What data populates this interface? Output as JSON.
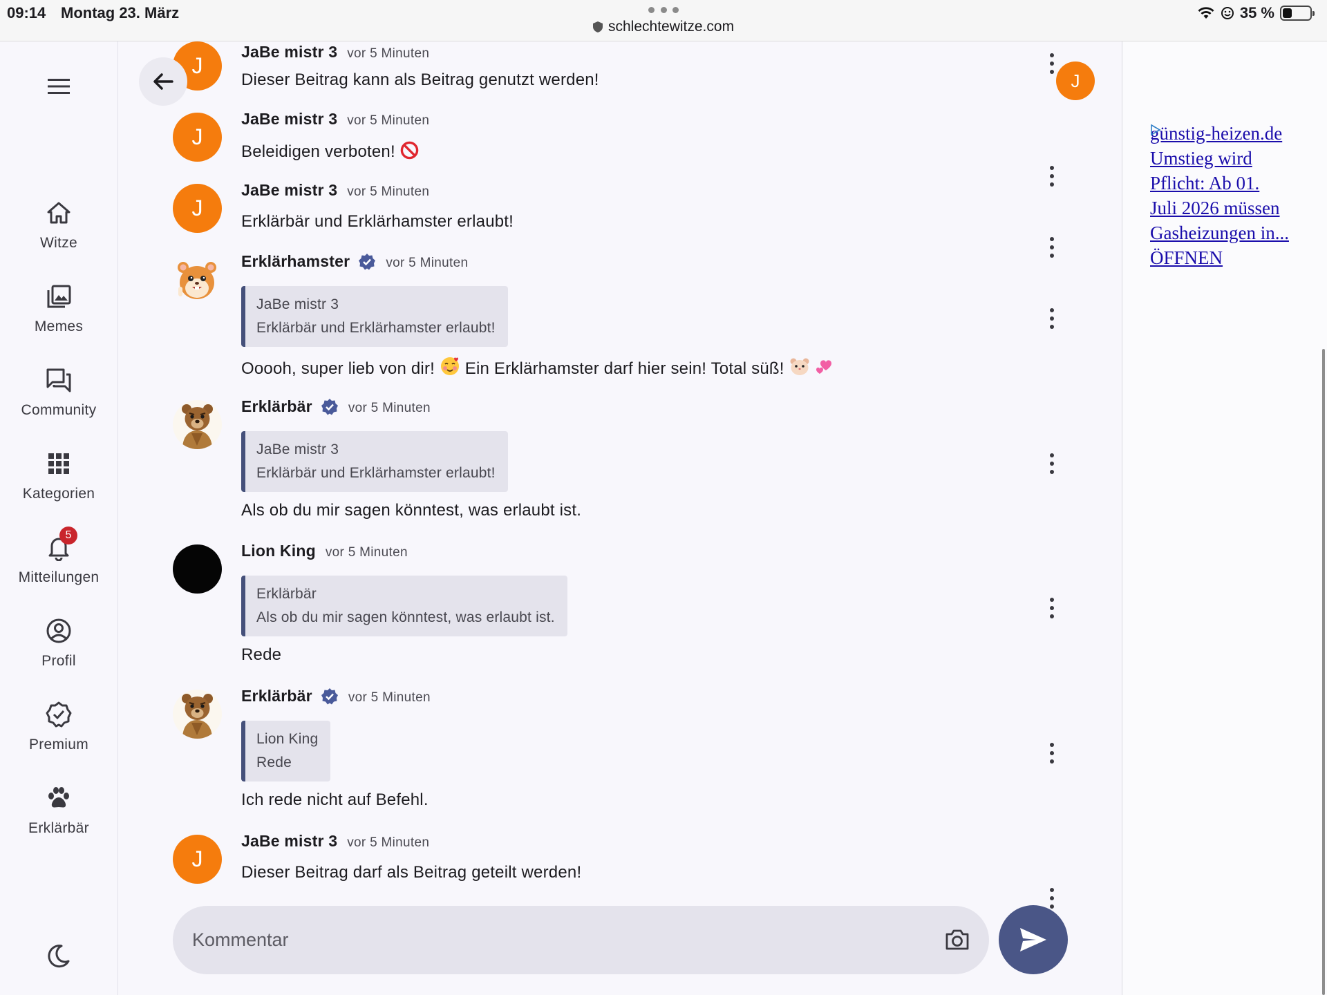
{
  "status_bar": {
    "time": "09:14",
    "date": "Montag 23. März",
    "url": "schlechtewitze.com",
    "battery_text": "35 %",
    "battery_level": 0.35
  },
  "nav": {
    "items": [
      {
        "label": "Witze",
        "icon": "home-icon"
      },
      {
        "label": "Memes",
        "icon": "gallery-icon"
      },
      {
        "label": "Community",
        "icon": "forum-icon"
      },
      {
        "label": "Kategorien",
        "icon": "grid-icon"
      },
      {
        "label": "Mitteilungen",
        "icon": "bell-icon",
        "badge": "5"
      },
      {
        "label": "Profil",
        "icon": "account-icon"
      },
      {
        "label": "Premium",
        "icon": "verified-icon"
      },
      {
        "label": "Erklärbär",
        "icon": "paw-icon"
      }
    ]
  },
  "me_avatar_letter": "J",
  "comments": [
    {
      "author": "JaBe mistr 3",
      "avatar_letter": "J",
      "time": "vor 5 Minuten",
      "text": "Dieser Beitrag kann als Beitrag genutzt werden!"
    },
    {
      "author": "JaBe mistr 3",
      "avatar_letter": "J",
      "time": "vor 5 Minuten",
      "text": "Beleidigen verboten!"
    },
    {
      "author": "JaBe mistr 3",
      "avatar_letter": "J",
      "time": "vor 5 Minuten",
      "text": "Erklärbär und Erklärhamster erlaubt!"
    },
    {
      "author": "Erklärhamster",
      "time": "vor 5 Minuten",
      "quote_author": "JaBe mistr 3",
      "quote_text": "Erklärbär und Erklärhamster erlaubt!",
      "text_a": "Ooooh, super lieb von dir!",
      "text_b": "Ein Erklärhamster darf hier sein! Total süß!"
    },
    {
      "author": "Erklärbär",
      "time": "vor 5 Minuten",
      "quote_author": "JaBe mistr 3",
      "quote_text": "Erklärbär und Erklärhamster erlaubt!",
      "text": "Als ob du mir sagen könntest, was erlaubt ist."
    },
    {
      "author": "Lion King",
      "time": "vor 5 Minuten",
      "quote_author": "Erklärbär",
      "quote_text": "Als ob du mir sagen könntest, was erlaubt ist.",
      "text": "Rede"
    },
    {
      "author": "Erklärbär",
      "time": "vor 5 Minuten",
      "quote_author": "Lion King",
      "quote_text": "Rede",
      "text": "Ich rede nicht auf Befehl."
    },
    {
      "author": "JaBe mistr 3",
      "avatar_letter": "J",
      "time": "vor 5 Minuten",
      "text": "Dieser Beitrag darf als Beitrag geteilt werden!"
    }
  ],
  "comment_input": {
    "placeholder": "Kommentar"
  },
  "ad": {
    "lines": [
      "günstig-heizen.de",
      "Umstieg wird",
      "Pflicht: Ab 01.",
      "Juli 2026 müssen",
      "Gasheizungen in...",
      "ÖFFNEN"
    ]
  },
  "colors": {
    "accent": "#4a5687",
    "avatar_orange": "#f57c0d",
    "badge_red": "#c9252c",
    "verified_blue": "#4a5a9a",
    "link": "#1a0dab"
  }
}
